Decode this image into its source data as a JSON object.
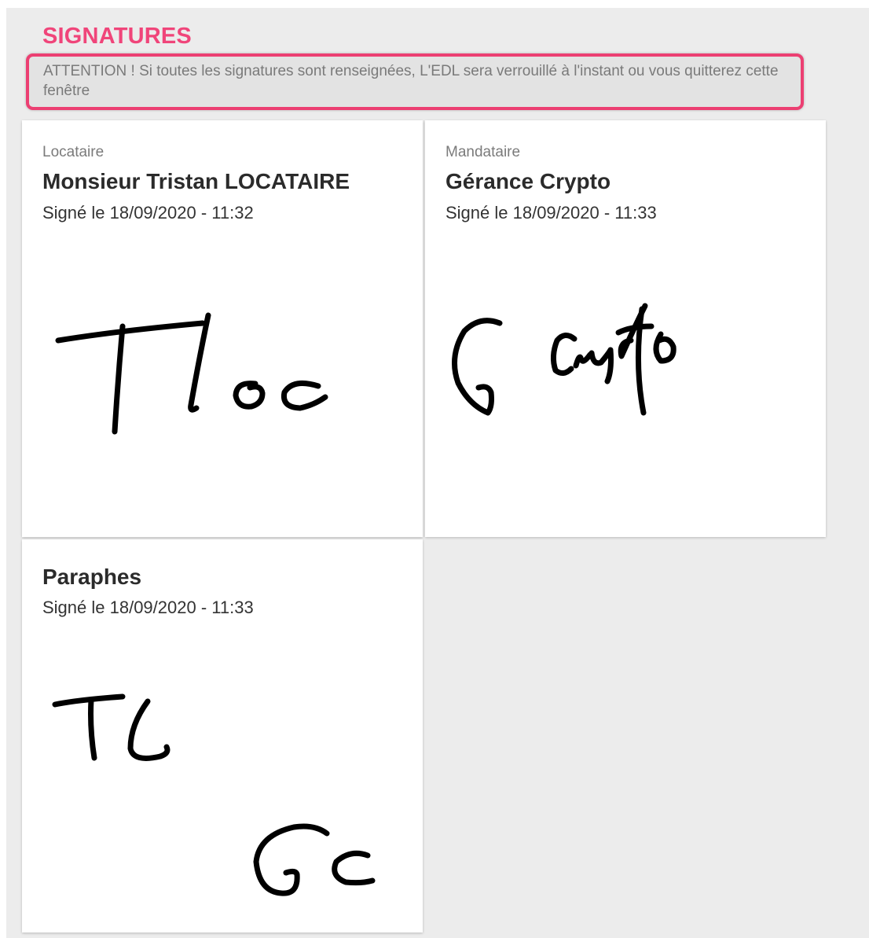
{
  "section": {
    "title": "SIGNATURES",
    "warning": "ATTENTION ! Si toutes les signatures sont renseignées, L'EDL sera verrouillé à l'instant ou vous quitterez cette fenêtre"
  },
  "cards": [
    {
      "role": "Locataire",
      "name": "Monsieur Tristan LOCATAIRE",
      "date": "Signé le 18/09/2020 - 11:32"
    },
    {
      "role": "Mandataire",
      "name": "Gérance Crypto",
      "date": "Signé le 18/09/2020 - 11:33"
    },
    {
      "name": "Paraphes",
      "date": "Signé le 18/09/2020 - 11:33"
    }
  ]
}
